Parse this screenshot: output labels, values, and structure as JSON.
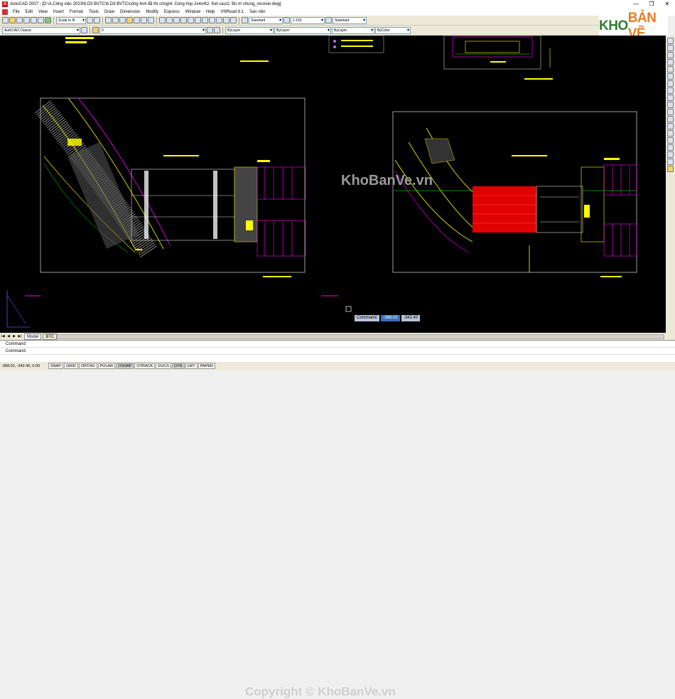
{
  "window": {
    "title": "AutoCAD 2007 - [D:\\A.Công việc 2023\\6.D3 BVTC\\6.D3 BVTC\\cống 4x4 đã thi công\\4. Cong hop 2x4x4\\2. Ket cau\\2. Bo tri chung_recover.dwg]",
    "controls": [
      "—",
      "❐",
      "✕"
    ]
  },
  "menu": [
    "File",
    "Edit",
    "View",
    "Insert",
    "Format",
    "Tools",
    "Draw",
    "Dimension",
    "Modify",
    "Express",
    "Window",
    "Help",
    "VNRoad 9.1",
    "San nền"
  ],
  "toolbar1": {
    "scale_combo": "Scale to fit",
    "text_style": "Standard",
    "dim_scale": "1:150",
    "dim_style": "Standard"
  },
  "toolbar2": {
    "workspace": "AutoCAD Classic",
    "layer": "0",
    "color": "ByLayer",
    "linetype": "ByLayer",
    "lineweight": "ByLayer",
    "plotstyle": "ByColor"
  },
  "logo": {
    "k": "KHO",
    "rest": "BẢN VẼ"
  },
  "canvas": {
    "watermark": "KhoBanVe.vn",
    "dyn_label": "Command:",
    "dyn_x": "-368.02",
    "dyn_y": "-342.40"
  },
  "tabs": {
    "nav": [
      "|◀",
      "◀",
      "▶",
      "▶|"
    ],
    "items": [
      "Model",
      "BTC"
    ]
  },
  "command": {
    "line1": "Command:",
    "line2": "Command:"
  },
  "bottom_watermark": "Copyright © KhoBanVe.vn",
  "status": {
    "coords": "-368.02, -342.40, 0.00",
    "toggles": [
      "SNAP",
      "GRID",
      "ORTHO",
      "POLAR",
      "OSNAP",
      "OTRACK",
      "DUCS",
      "DYN",
      "LWT",
      "PAPER"
    ]
  }
}
